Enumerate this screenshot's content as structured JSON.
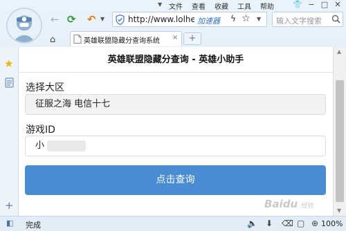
{
  "menu": {
    "items": [
      "文件",
      "查看",
      "收藏",
      "工具",
      "帮助"
    ],
    "window_controls": [
      "−",
      "□",
      "✕"
    ]
  },
  "toolbar": {
    "address": "http://www.lolhe",
    "accelerator_label": "加速器",
    "search_placeholder": "输入文字搜索"
  },
  "tab": {
    "title": "英雄联盟隐藏分查询系统",
    "close": "×",
    "new_tab": "+"
  },
  "page": {
    "header": "英雄联盟隐藏分查询 - 英雄小助手",
    "region_label": "选择大区",
    "region_value": "征服之海 电信十七",
    "game_id_label": "游戏ID",
    "game_id_value": "小",
    "submit_label": "点击查询"
  },
  "status": {
    "text": "完成",
    "zoom": "100%"
  },
  "watermark": {
    "brand": "Bai",
    "paw": "du",
    "suffix": "经验"
  },
  "colors": {
    "accent": "#4a8cd1",
    "link": "#2a6fc4"
  }
}
